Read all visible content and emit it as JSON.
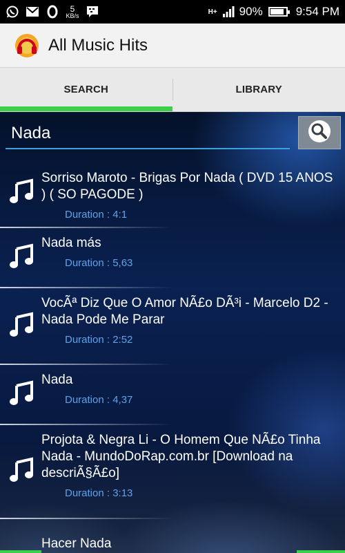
{
  "status_bar": {
    "speed_value": "5",
    "speed_unit": "KB/s",
    "network": "H+",
    "battery": "90%",
    "battery_level": 0.9,
    "time": "9:54 PM",
    "left_icons": [
      "whatsapp-icon",
      "gmail-icon",
      "opera-icon",
      "bbm-icon"
    ]
  },
  "app": {
    "title": "All Music Hits"
  },
  "tabs": [
    {
      "label": "SEARCH",
      "active": true
    },
    {
      "label": "LIBRARY",
      "active": false
    }
  ],
  "search": {
    "value": "Nada",
    "placeholder": ""
  },
  "results": [
    {
      "title": "Sorriso Maroto -  Brigas Por Nada ( DVD 15 ANOS ) ( SO PAGODE )",
      "duration": "Duration : 4:1"
    },
    {
      "title": "Nada más",
      "duration": "Duration : 5,63"
    },
    {
      "title": "VocÃª Diz Que O Amor NÃ£o DÃ³i - Marcelo D2 - Nada Pode Me Parar",
      "duration": "Duration : 2:52"
    },
    {
      "title": "Nada",
      "duration": "Duration : 4,37"
    },
    {
      "title": "Projota & Negra Li - O Homem Que NÃ£o Tinha Nada - MundoDoRap.com.br [Download na descriÃ§Ã£o]",
      "duration": "Duration : 3:13"
    },
    {
      "title": "Hacer Nada",
      "duration": ""
    }
  ],
  "colors": {
    "accent_green": "#3bd04a",
    "duration_blue": "#5ea3ea",
    "input_underline": "#3aa2dc"
  }
}
